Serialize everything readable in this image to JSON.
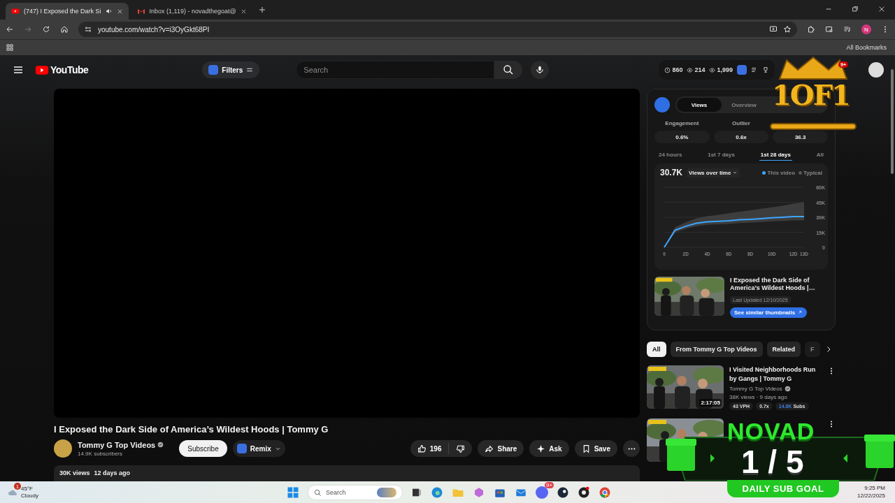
{
  "browser": {
    "tabs": [
      {
        "title": "(747) I Exposed the Dark Si",
        "selected": true,
        "kind": "youtube",
        "audio": true
      },
      {
        "title": "Inbox (1,119) - novadthegoat@",
        "selected": false,
        "kind": "gmail",
        "audio": false
      }
    ],
    "url": "youtube.com/watch?v=i3OyGkt68PI",
    "profile_initial": "N",
    "bookmarks": "All Bookmarks"
  },
  "masthead": {
    "logo": "YouTube",
    "filters": "Filters",
    "search_placeholder": "Search",
    "stats": [
      "860",
      "214",
      "1,999"
    ],
    "notifications": "9+"
  },
  "video": {
    "title": "I Exposed the Dark Side of America’s Wildest Hoods | Tommy G",
    "channel": "Tommy G Top Videos",
    "verified": true,
    "subscribers": "14.9K subscribers",
    "subscribe": "Subscribe",
    "remix": "Remix",
    "likes": "196",
    "actions": [
      "Share",
      "Ask",
      "Save"
    ],
    "views": "30K views",
    "age": "12 days ago"
  },
  "insights": {
    "tabs": [
      {
        "label": "Views",
        "selected": true
      },
      {
        "label": "Overview",
        "selected": false
      }
    ],
    "metrics": [
      {
        "label": "Engagement",
        "value": "0.6%"
      },
      {
        "label": "Outlier",
        "value": "0.6x"
      },
      {
        "value": "36.3"
      }
    ],
    "ranges": [
      {
        "label": "24 hours",
        "selected": false
      },
      {
        "label": "1st 7 days",
        "selected": false
      },
      {
        "label": "1st 28 days",
        "selected": true
      },
      {
        "label": "All",
        "selected": false
      }
    ],
    "total": "30.7K",
    "dropdown": "Views over time",
    "chart_data": {
      "type": "line",
      "x": [
        0,
        1,
        2,
        3,
        4,
        5,
        6,
        7,
        8,
        9,
        10,
        11,
        12,
        13
      ],
      "series": [
        {
          "name": "This video",
          "color": "#3ea6ff",
          "values": [
            0,
            17000,
            21000,
            24000,
            25500,
            26000,
            26500,
            27500,
            28000,
            28700,
            29500,
            30000,
            30600,
            30700
          ]
        },
        {
          "name": "Typical",
          "type": "area",
          "color": "#555555",
          "values": [
            0,
            20000,
            25000,
            29000,
            31000,
            32500,
            34000,
            35500,
            37000,
            38500,
            40000,
            41500,
            43500,
            45000
          ]
        }
      ],
      "xticks": [
        {
          "value": 0,
          "label": "0"
        },
        {
          "value": 2,
          "label": "2D"
        },
        {
          "value": 4,
          "label": "4D"
        },
        {
          "value": 6,
          "label": "6D"
        },
        {
          "value": 8,
          "label": "8D"
        },
        {
          "value": 10,
          "label": "10D"
        },
        {
          "value": 12,
          "label": "12D"
        },
        {
          "value": 13,
          "label": "13D"
        }
      ],
      "yticks": [
        {
          "value": 0,
          "label": "0"
        },
        {
          "value": 15000,
          "label": "15K"
        },
        {
          "value": 30000,
          "label": "30K"
        },
        {
          "value": 45000,
          "label": "45K"
        },
        {
          "value": 60000,
          "label": "60K"
        }
      ],
      "xlim": [
        0,
        13
      ],
      "ylim": [
        0,
        60000
      ],
      "grid": true
    },
    "thumb_card": {
      "title": "I Exposed the Dark Side of America’s Wildest Hoods |…",
      "updated": "Last Updated 12/10/2025",
      "button": "See similar thumbnails"
    }
  },
  "chips": [
    {
      "label": "All",
      "selected": true
    },
    {
      "label": "From Tommy G Top Videos",
      "selected": false
    },
    {
      "label": "Related",
      "selected": false
    },
    {
      "label": "F",
      "selected": false
    }
  ],
  "recommended": [
    {
      "kind": "video",
      "title": "I Visited Neighborhoods Run by Gangs | Tommy G",
      "channel": "Tommy G Top Videos",
      "verified": true,
      "meta": "38K views · 9 days ago",
      "duration": "2:17:05",
      "badges": [
        "43 VPH",
        "0.7x"
      ],
      "subs": "14.8K",
      "subs_label": "Subs"
    },
    {
      "kind": "partial"
    }
  ],
  "overlays": {
    "logo": "1OF1",
    "goal": {
      "name": "NOVAD",
      "count": "1 / 5",
      "label": "DAILY SUB GOAL"
    }
  },
  "taskbar": {
    "weather": {
      "temp": "45°F",
      "condition": "Cloudy",
      "alerts": "1"
    },
    "search": "Search",
    "chat_badge": "9+",
    "time": "9:25 PM",
    "date": "12/22/2025"
  }
}
